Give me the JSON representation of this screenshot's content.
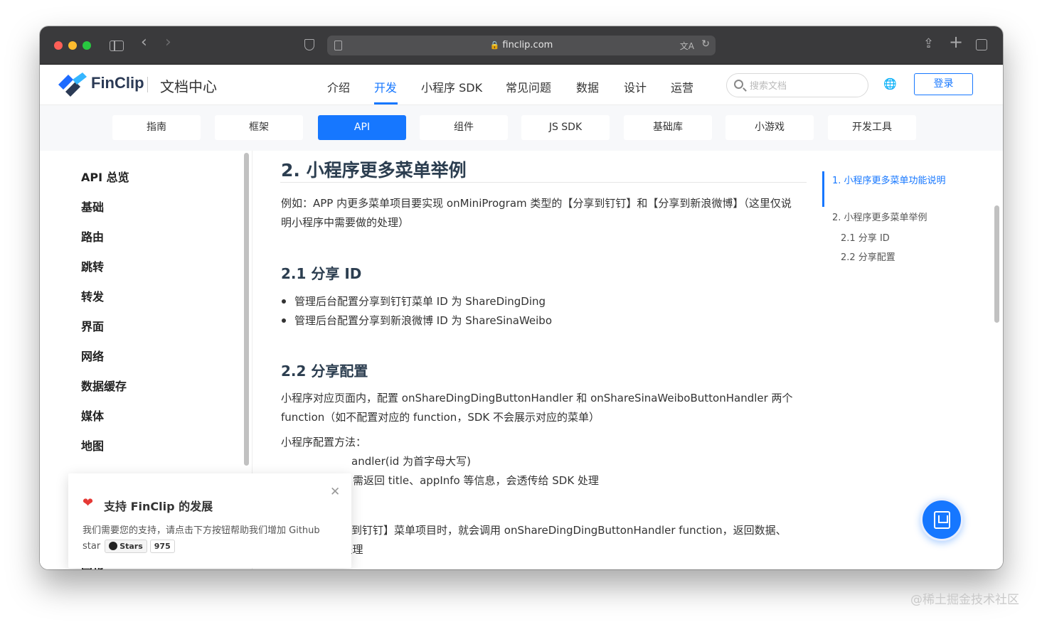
{
  "browser": {
    "url": "finclip.com"
  },
  "header": {
    "logo_text": "FinClip",
    "doc_center": "文档中心",
    "nav": [
      "介绍",
      "开发",
      "小程序 SDK",
      "常见问题",
      "数据",
      "设计",
      "运营"
    ],
    "active_nav": "开发",
    "search_placeholder": "搜索文档",
    "login_label": "登录"
  },
  "subnav": {
    "tabs": [
      "指南",
      "框架",
      "API",
      "组件",
      "JS SDK",
      "基础库",
      "小游戏",
      "开发工具"
    ],
    "active": "API"
  },
  "sidebar": {
    "items": [
      "API 总览",
      "基础",
      "路由",
      "跳转",
      "转发",
      "界面",
      "网络",
      "数据缓存",
      "媒体",
      "地图",
      "画布"
    ]
  },
  "content": {
    "h2": "2. 小程序更多菜单举例",
    "intro": "例如：APP 内更多菜单项目要实现 onMiniProgram 类型的【分享到钉钉】和【分享到新浪微博】（这里仅说明小程序中需要做的处理）",
    "h3_1": "2.1 分享 ID",
    "list_1": [
      "管理后台配置分享到钉钉菜单 ID 为 ShareDingDing",
      "管理后台配置分享到新浪微博 ID 为 ShareSinaWeibo"
    ],
    "h3_2": "2.2 分享配置",
    "p2": "小程序对应页面内，配置 onShareDingDingButtonHandler 和 onShareSinaWeiboButtonHandler 两个 function（如不配置对应的 function，SDK 不会展示对应的菜单）",
    "p3": "小程序配置方法：",
    "p4": "andler(id 为首字母大写)",
    "p5": "需返回 title、appInfo 等信息，会透传给 SDK 处理",
    "p6": "到钉钉】菜单项目时，就会调用 onShareDingDingButtonHandler function，返回数据、",
    "p7": "透传给 SDK 处理"
  },
  "toc": {
    "items": [
      "1. 小程序更多菜单功能说明",
      "2. 小程序更多菜单举例",
      "2.1 分享 ID",
      "2.2 分享配置"
    ]
  },
  "popup": {
    "title": "支持 FinClip 的发展",
    "text": "我们需要您的支持，请点击下方按钮帮助我们增加 Github star",
    "stars_label": "Stars",
    "stars_count": "975"
  },
  "watermark": "@稀土掘金技术社区",
  "colors": {
    "accent": "#1677ff",
    "heart": "#e53935"
  }
}
